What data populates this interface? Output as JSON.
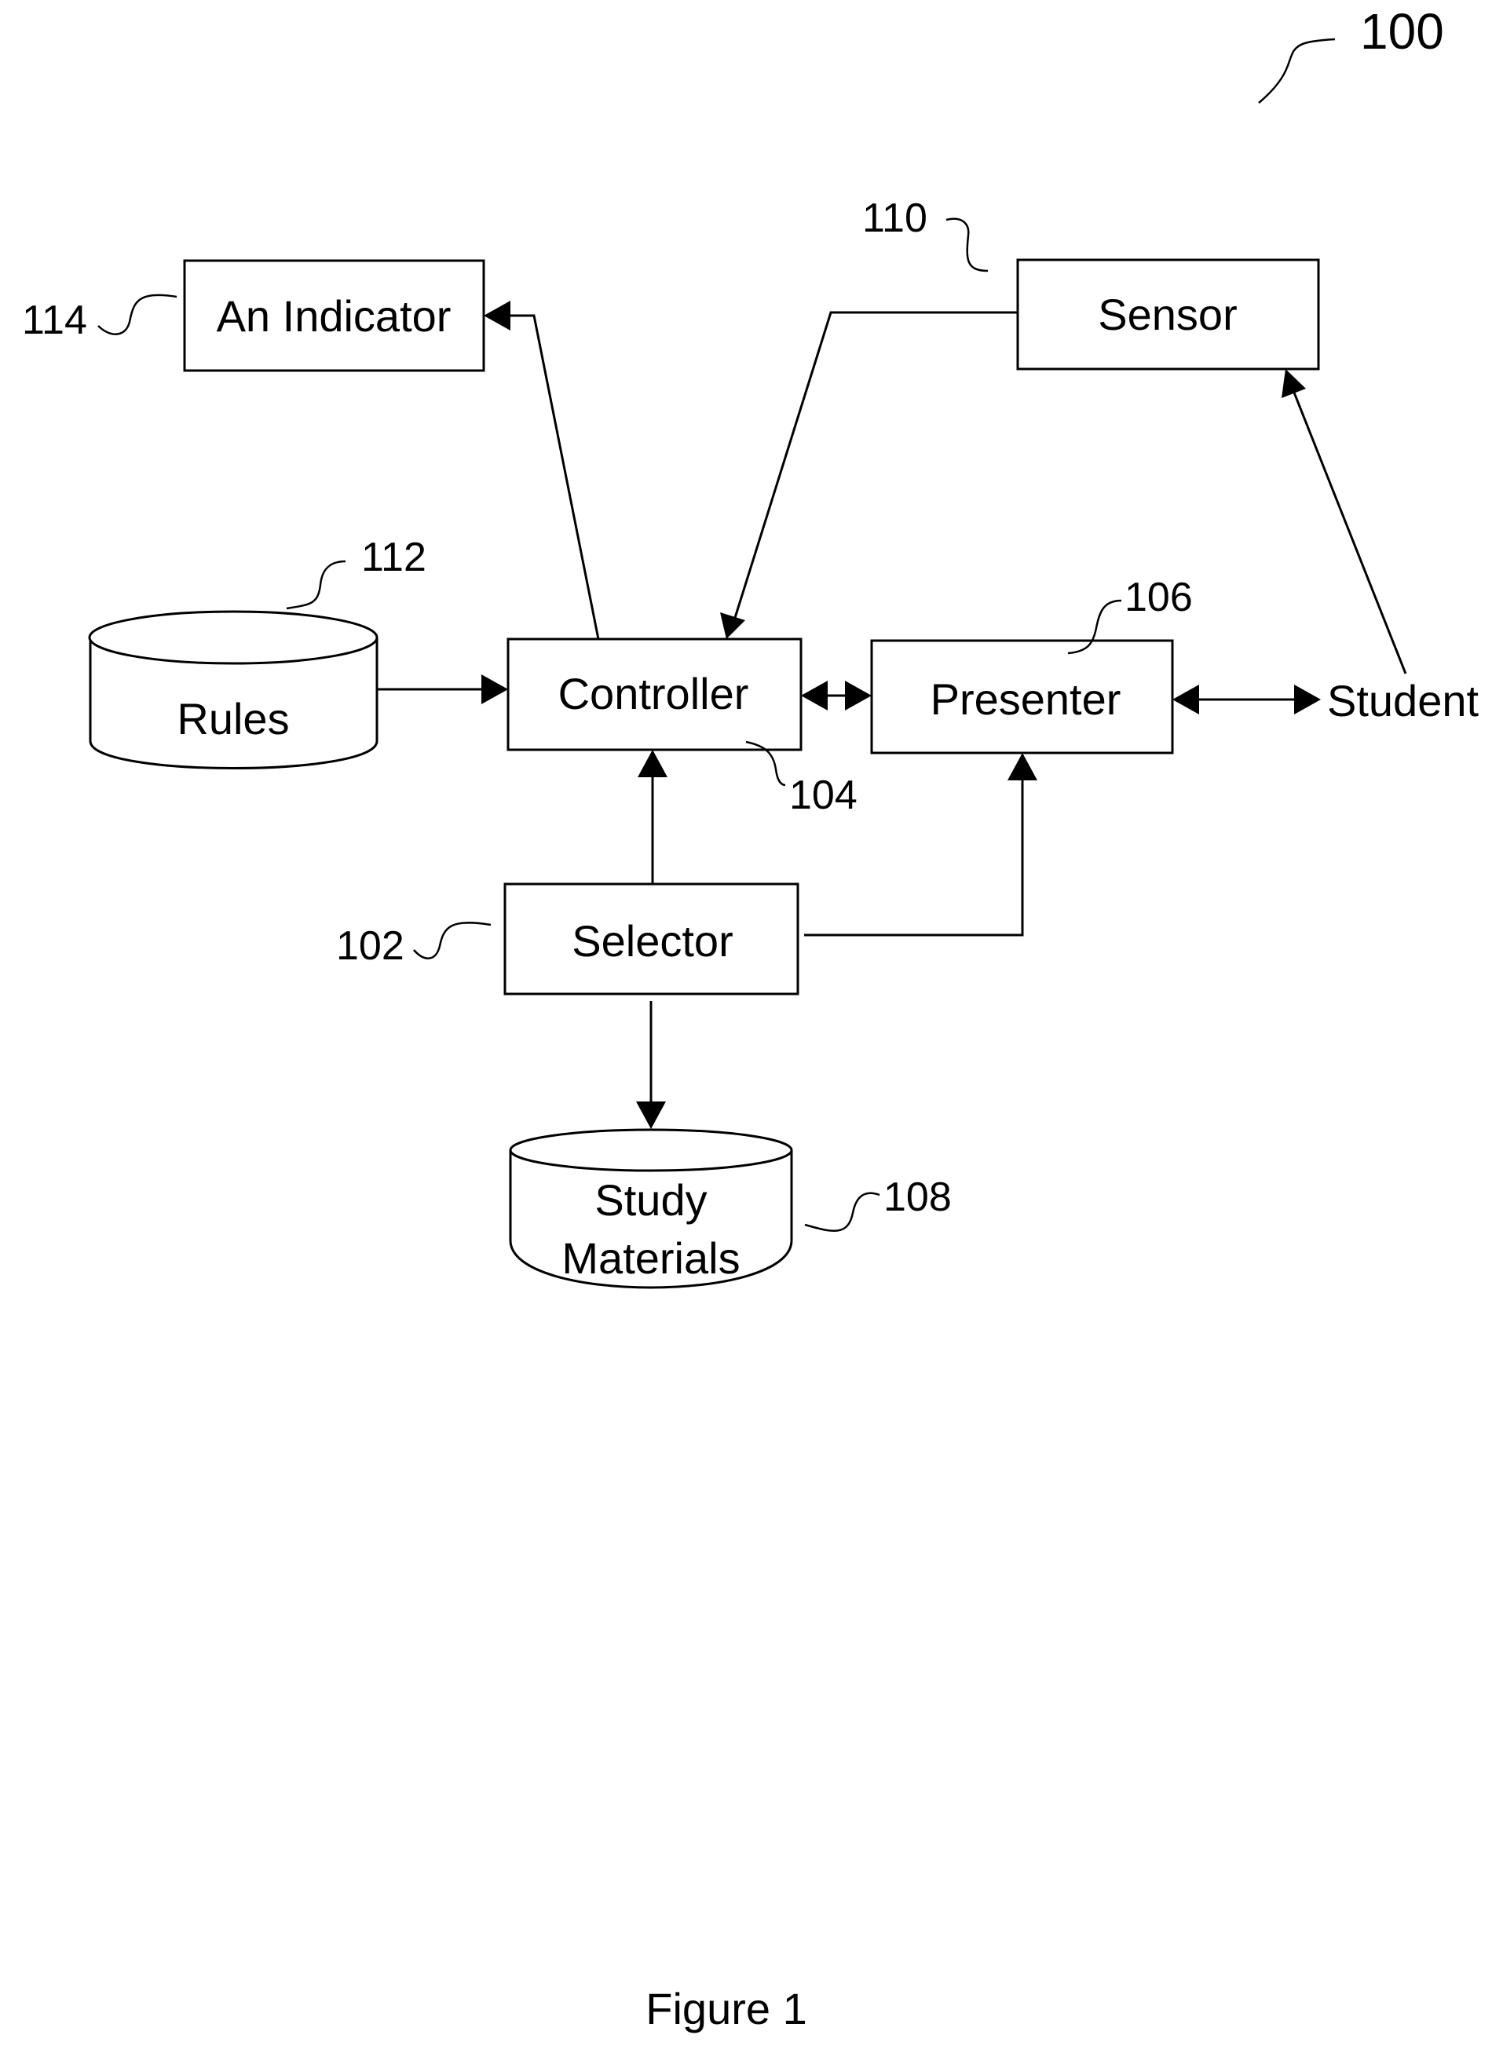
{
  "figure": {
    "number_label": "100",
    "caption": "Figure 1"
  },
  "nodes": {
    "indicator": {
      "label": "An Indicator",
      "ref": "114"
    },
    "sensor": {
      "label": "Sensor",
      "ref": "110"
    },
    "rules": {
      "label": "Rules",
      "ref": "112"
    },
    "controller": {
      "label": "Controller",
      "ref": "104"
    },
    "presenter": {
      "label": "Presenter",
      "ref": "106"
    },
    "student": {
      "label": "Student"
    },
    "selector": {
      "label": "Selector",
      "ref": "102"
    },
    "study_materials": {
      "label_line1": "Study",
      "label_line2": "Materials",
      "ref": "108"
    }
  },
  "edges": [
    {
      "from": "controller",
      "to": "indicator",
      "direction": "forward"
    },
    {
      "from": "sensor",
      "to": "controller",
      "direction": "forward"
    },
    {
      "from": "student",
      "to": "sensor",
      "direction": "forward"
    },
    {
      "from": "rules",
      "to": "controller",
      "direction": "forward"
    },
    {
      "from": "controller",
      "to": "presenter",
      "direction": "bidirectional"
    },
    {
      "from": "presenter",
      "to": "student",
      "direction": "bidirectional"
    },
    {
      "from": "selector",
      "to": "controller",
      "direction": "forward"
    },
    {
      "from": "selector",
      "to": "presenter",
      "direction": "forward"
    },
    {
      "from": "selector",
      "to": "study_materials",
      "direction": "forward"
    }
  ]
}
